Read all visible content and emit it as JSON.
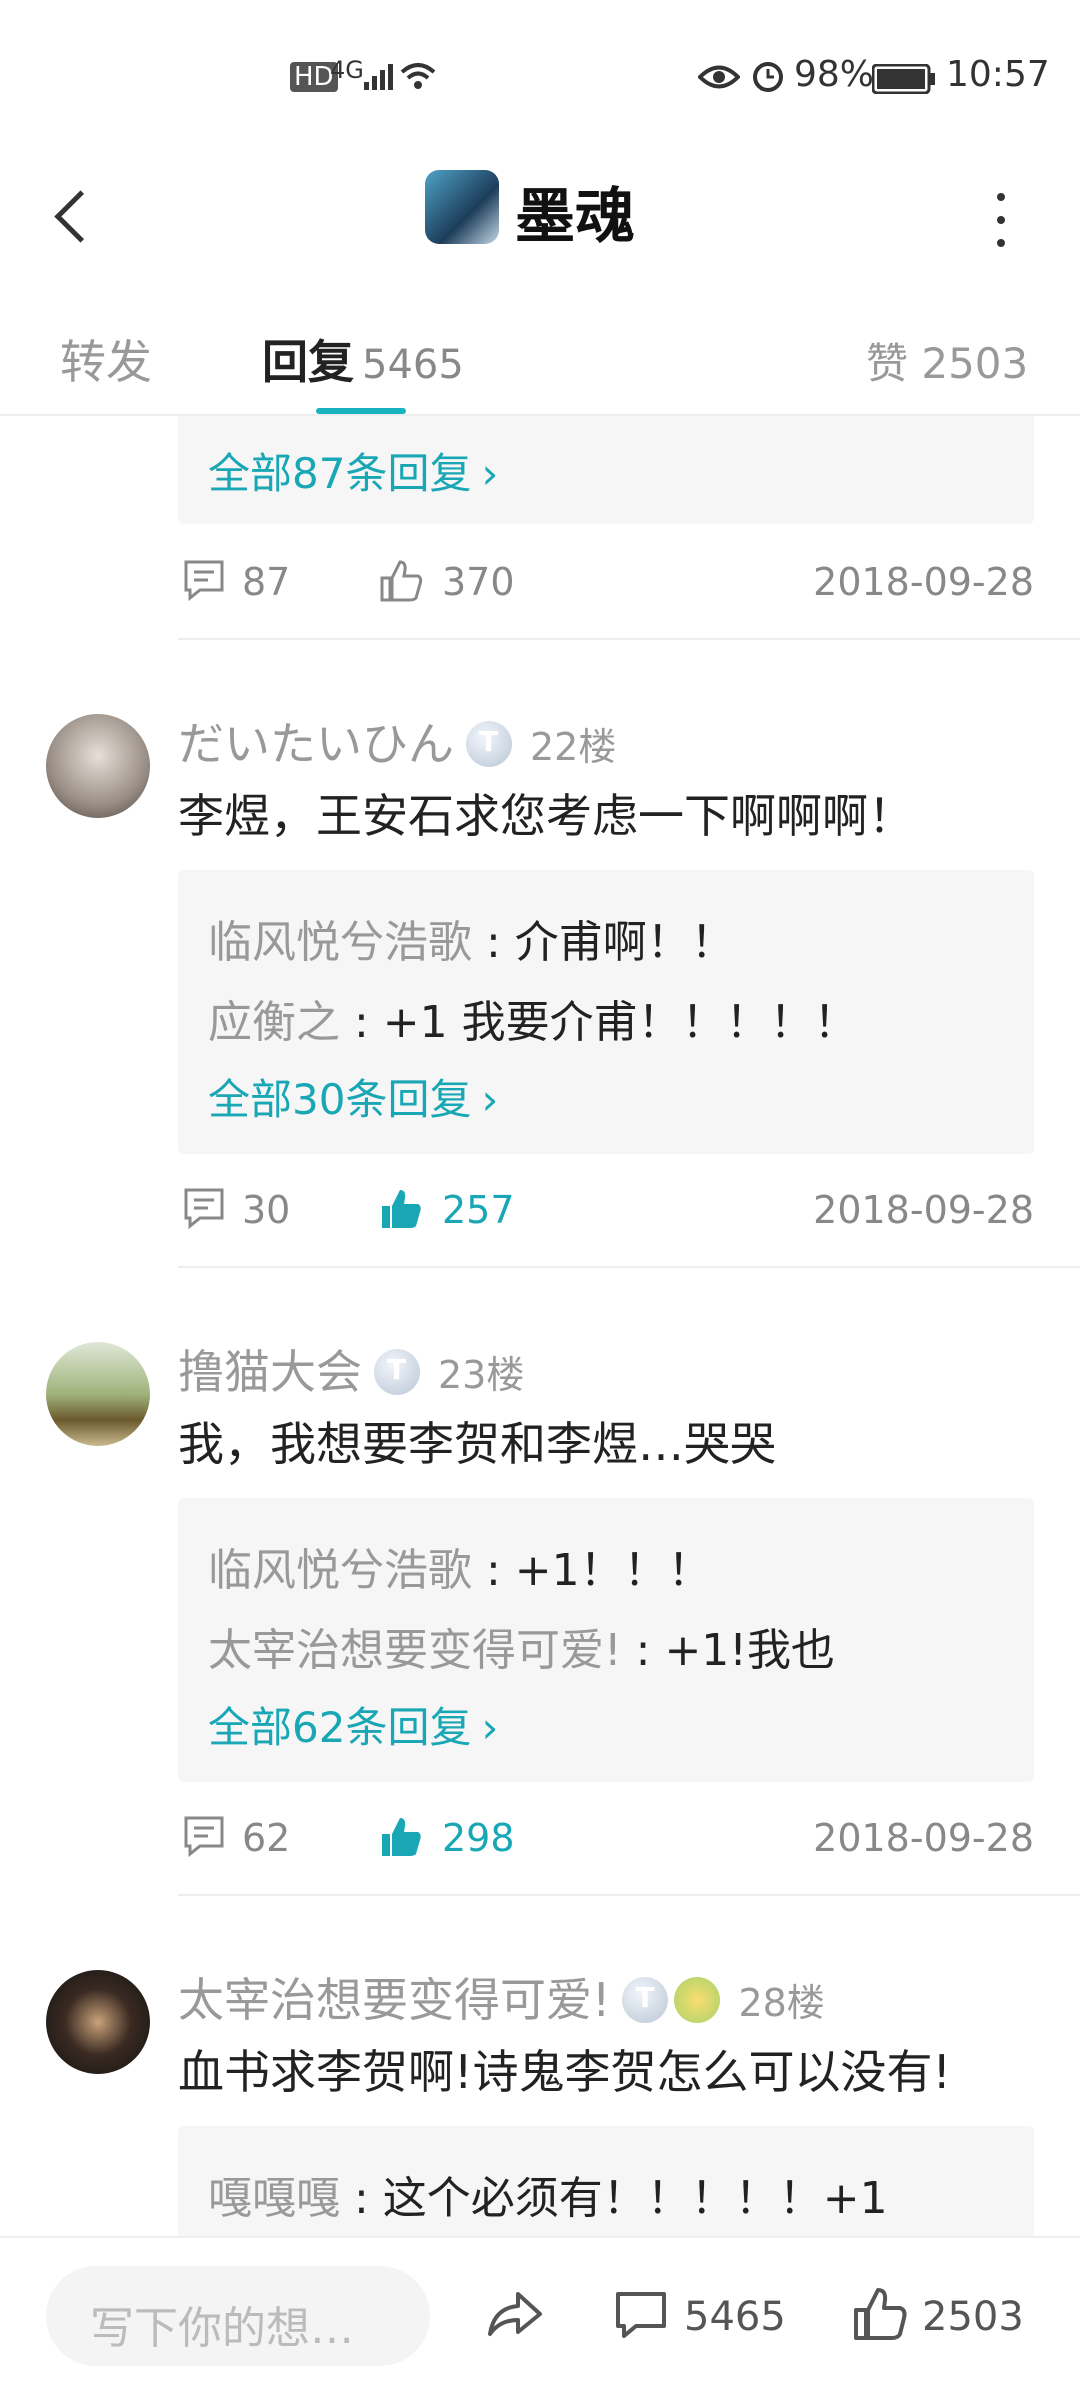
{
  "status_bar": {
    "network": "4G",
    "battery": "98%",
    "time": "10:57"
  },
  "header": {
    "title": "墨魂"
  },
  "tabs": {
    "forward": "转发",
    "reply_label": "回复",
    "reply_count": "5465",
    "likes": "赞 2503"
  },
  "top_card": {
    "all_replies": "全部87条回复",
    "comments": "87",
    "likes": "370",
    "date": "2018-09-28"
  },
  "posts": [
    {
      "username": "だいたいひん",
      "floor": "22楼",
      "text": "李煜，王安石求您考虑一下啊啊啊！",
      "replies": [
        {
          "user": "临风悦兮浩歌",
          "text": "介甫啊！！"
        },
        {
          "user": "应衡之",
          "text": "+1 我要介甫！！！！！"
        }
      ],
      "all_replies": "全部30条回复",
      "comments": "30",
      "likes": "257",
      "date": "2018-09-28"
    },
    {
      "username": "撸猫大会",
      "floor": "23楼",
      "text": "我，我想要李贺和李煜…哭哭",
      "replies": [
        {
          "user": "临风悦兮浩歌",
          "text": "+1！！！"
        },
        {
          "user": "太宰治想要变得可爱!",
          "text": "+1!我也"
        }
      ],
      "all_replies": "全部62条回复",
      "comments": "62",
      "likes": "298",
      "date": "2018-09-28"
    },
    {
      "username": "太宰治想要变得可爱!",
      "floor": "28楼",
      "text": "血书求李贺啊!诗鬼李贺怎么可以没有!",
      "replies": [
        {
          "user": "嘎嘎嘎",
          "text": "这个必须有！！！！！+1"
        }
      ]
    }
  ],
  "bottom_bar": {
    "input_placeholder": "写下你的想…",
    "comments": "5465",
    "likes": "2503"
  },
  "colors": {
    "accent": "#19a7b5",
    "muted": "#999999"
  }
}
